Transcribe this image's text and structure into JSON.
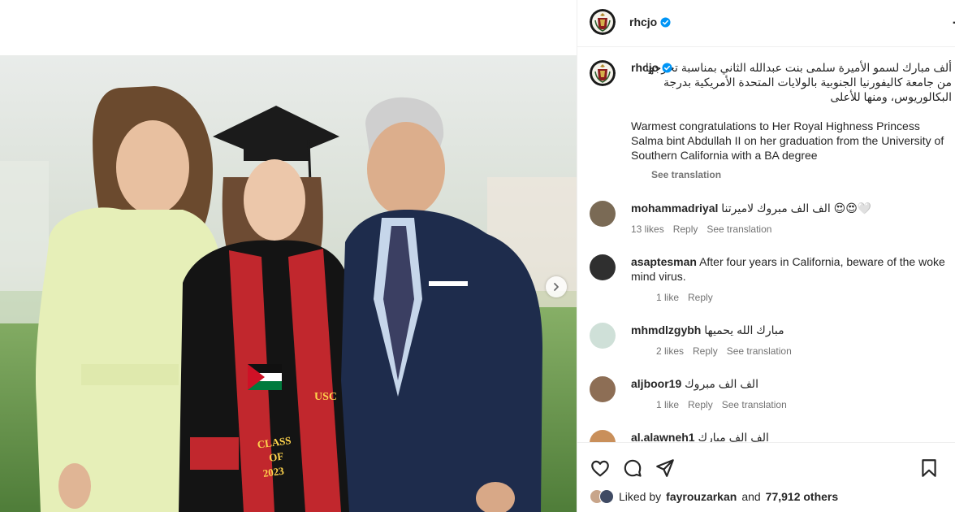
{
  "post": {
    "username": "rhcjo",
    "caption_ar": "ألف مبارك لسمو الأميرة سلمى بنت عبدالله الثاني بمناسبة تخرجها من جامعة كاليفورنيا الجنوبية بالولايات المتحدة الأمريكية بدرجة البكالوريوس، ومنها للأعلى",
    "caption_en": "Warmest congratulations to Her Royal Highness Princess Salma bint Abdullah II on her graduation from the University of Southern California with a BA degree",
    "see_translation": "See translation",
    "photo_text": {
      "brand": "USC",
      "stole_line1": "CLASS",
      "stole_line2": "OF",
      "stole_line3": "2023"
    }
  },
  "comments": [
    {
      "username": "mohammadriyal",
      "text": "الف الف مبروك لاميرتنا 😍😍🤍",
      "likes": "13 likes",
      "reply": "Reply",
      "see_translation": "See translation"
    },
    {
      "username": "asaptesman",
      "text": "After four years in California, beware of the woke mind virus.",
      "likes": "1 like",
      "reply": "Reply"
    },
    {
      "username": "mhmdlzgybh",
      "text": "مبارك الله يحميها",
      "likes": "2 likes",
      "reply": "Reply",
      "see_translation": "See translation"
    },
    {
      "username": "aljboor19",
      "text": "الف الف مبروك",
      "likes": "1 like",
      "reply": "Reply",
      "see_translation": "See translation"
    },
    {
      "username": "al.alawneh1",
      "text": "الف الف مبارك"
    }
  ],
  "likes_bar": {
    "prefix": "Liked by",
    "user": "fayrouzarkan",
    "middle": "and",
    "others": "77,912 others"
  },
  "icons": [
    "heart-icon",
    "comment-icon",
    "share-icon",
    "bookmark-icon",
    "verified-badge-icon",
    "chevron-right-icon",
    "more-options-icon"
  ],
  "colors": {
    "verified": "#0095f6",
    "meta": "#737373",
    "text": "#262626"
  }
}
